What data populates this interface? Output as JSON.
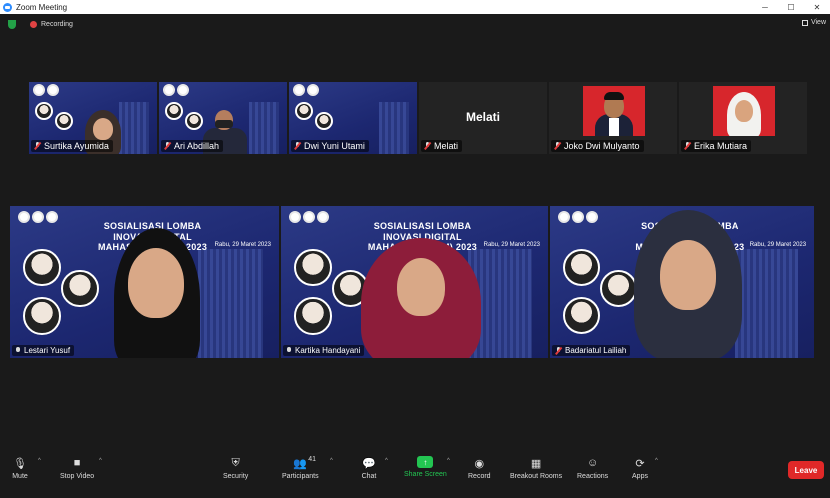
{
  "window": {
    "title": "Zoom Meeting",
    "minimize": "─",
    "maximize": "☐",
    "close": "✕"
  },
  "topbar": {
    "recording": "Recording",
    "view": "View"
  },
  "top_row": [
    {
      "name": "Surtika Ayumida"
    },
    {
      "name": "Ari Abdillah"
    },
    {
      "name": "Dwi Yuni Utami"
    },
    {
      "name": "Melati",
      "placeholder": "Melati"
    },
    {
      "name": "Joko Dwi Mulyanto"
    },
    {
      "name": "Erika Mutiara"
    }
  ],
  "main_row": [
    {
      "name": "Lestari Yusuf"
    },
    {
      "name": "Kartika Handayani"
    },
    {
      "name": "Badariatul Lailiah"
    }
  ],
  "slide": {
    "title_lines": [
      "SOSIALISASI LOMBA",
      "INOVASI DIGITAL",
      "MAHASISWA (IDM) 2023"
    ],
    "date": "Rabu, 29 Maret 2023"
  },
  "toolbar": {
    "mute": "Mute",
    "stop_video": "Stop Video",
    "security": "Security",
    "participants": "Participants",
    "participants_count": "41",
    "chat": "Chat",
    "share_screen": "Share Screen",
    "record": "Record",
    "breakout_rooms": "Breakout Rooms",
    "reactions": "Reactions",
    "apps": "Apps",
    "leave": "Leave"
  },
  "colors": {
    "accent_green": "#23c552",
    "leave_red": "#e02828",
    "active_speaker": "#c8e26a",
    "zoom_blue": "#2d8cff"
  }
}
